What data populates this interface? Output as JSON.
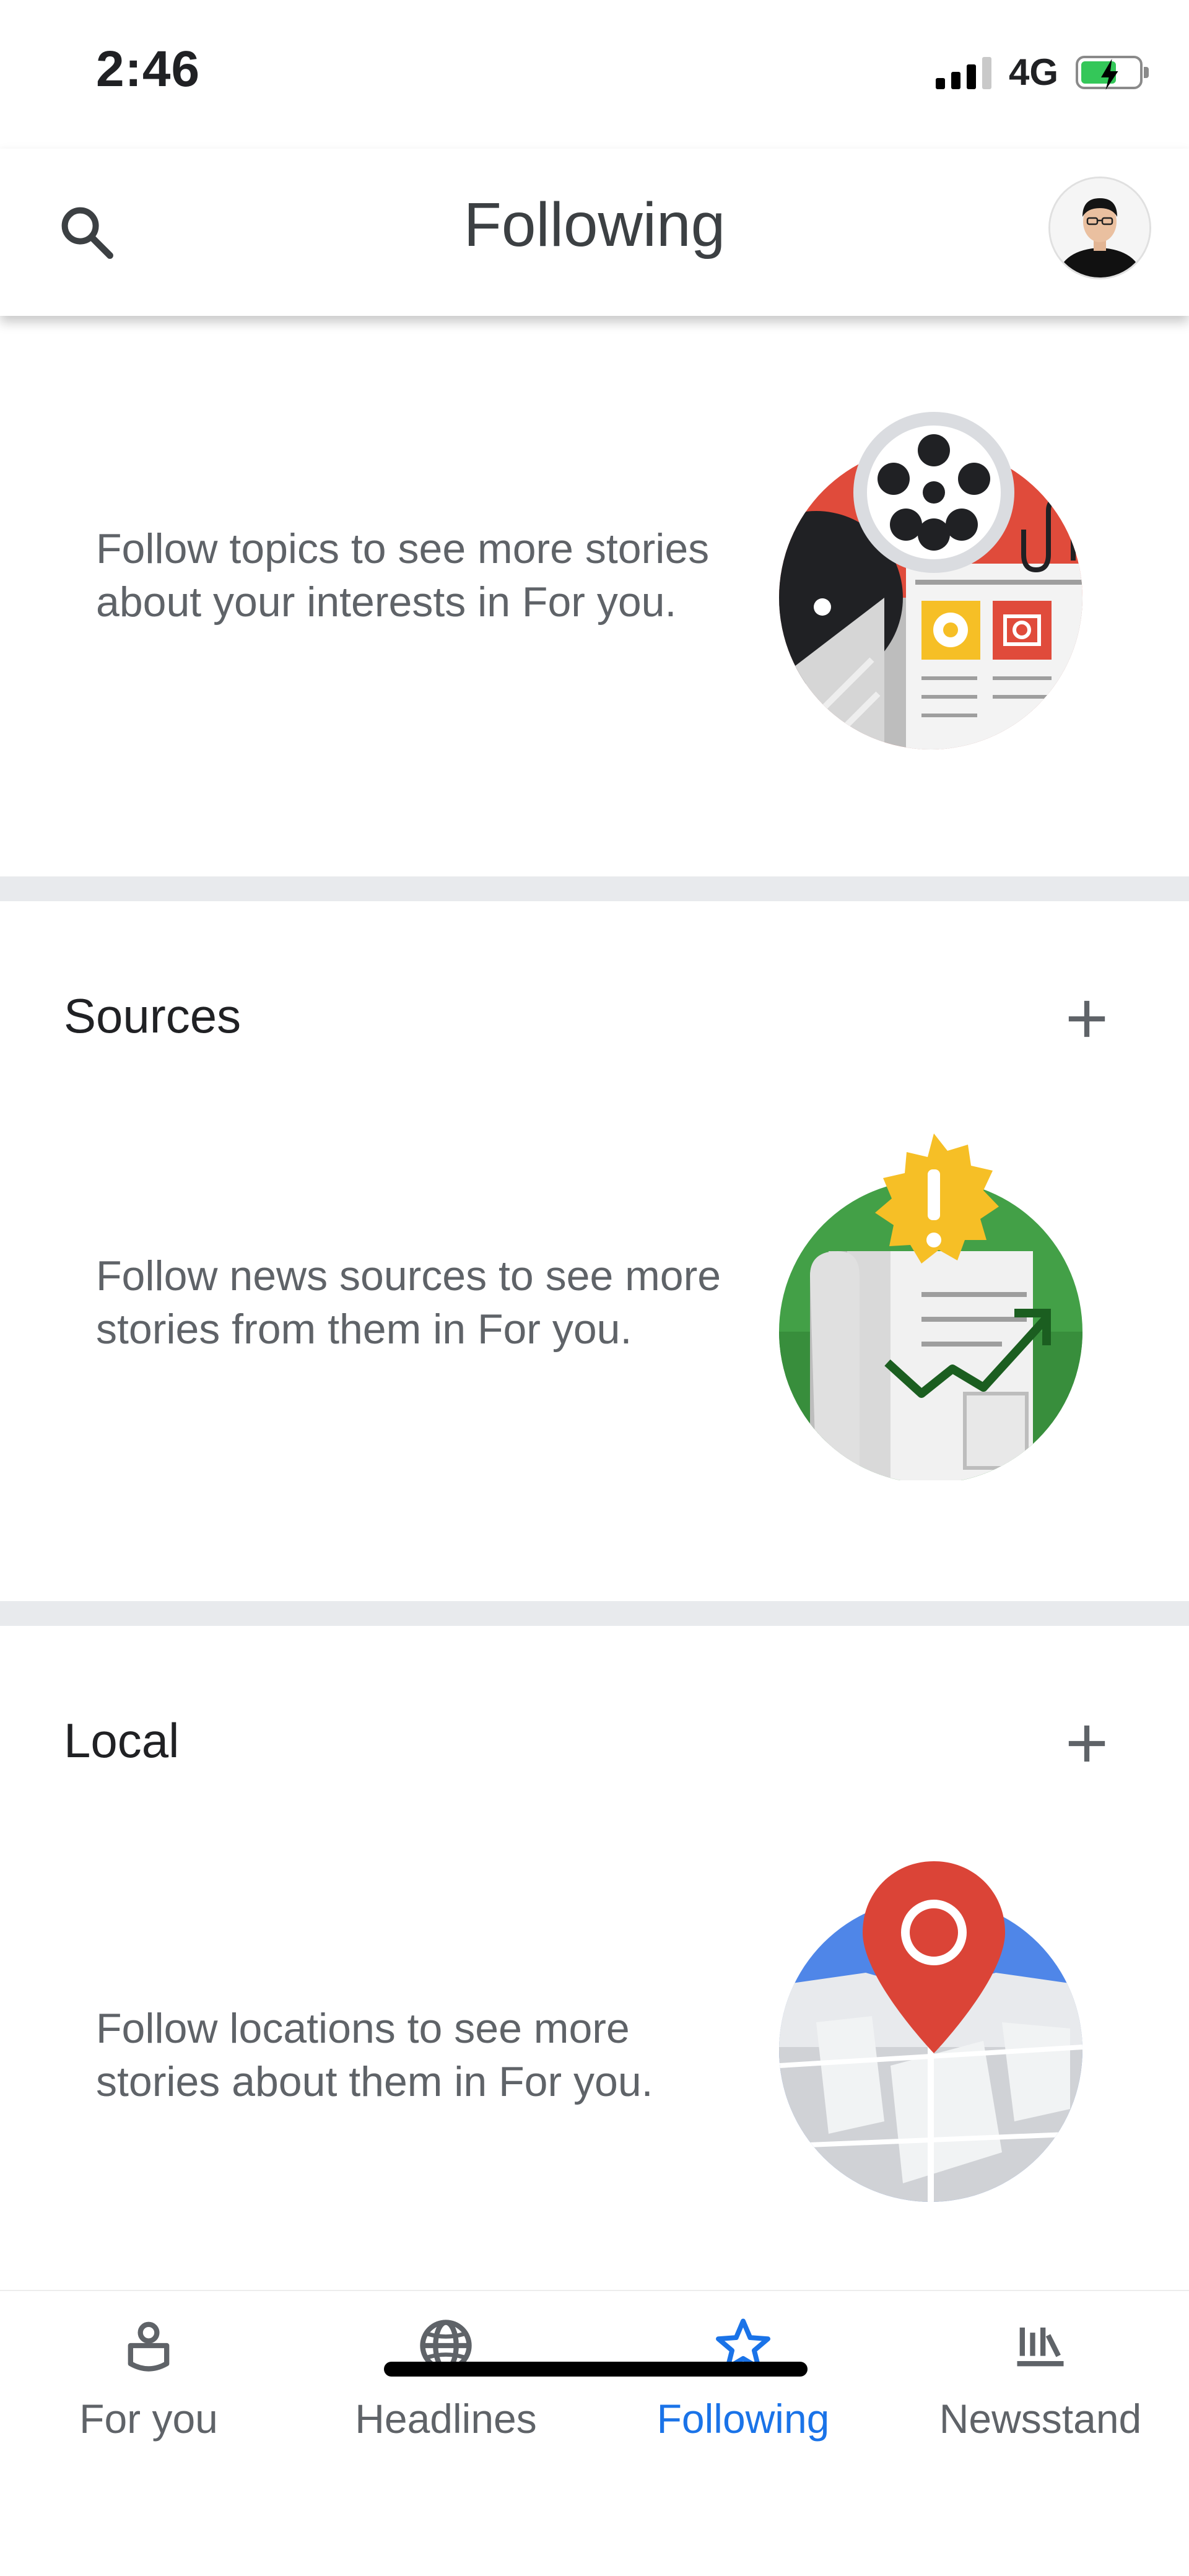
{
  "status_bar": {
    "time": "2:46",
    "network": "4G"
  },
  "header": {
    "title": "Following"
  },
  "topics": {
    "description": "Follow topics to see more stories about your interests in For you."
  },
  "sources": {
    "title": "Sources",
    "description": "Follow news sources to see more stories from them in For you."
  },
  "local": {
    "title": "Local",
    "description": "Follow locations to see more stories about them in For you."
  },
  "bottom_nav": {
    "items": [
      {
        "label": "For you",
        "icon": "for-you-icon"
      },
      {
        "label": "Headlines",
        "icon": "globe-icon"
      },
      {
        "label": "Following",
        "icon": "star-icon",
        "active": true
      },
      {
        "label": "Newsstand",
        "icon": "newsstand-icon"
      }
    ]
  },
  "colors": {
    "accent": "#1a73e8",
    "text_secondary": "#5f6368",
    "divider": "#e8eaed"
  }
}
